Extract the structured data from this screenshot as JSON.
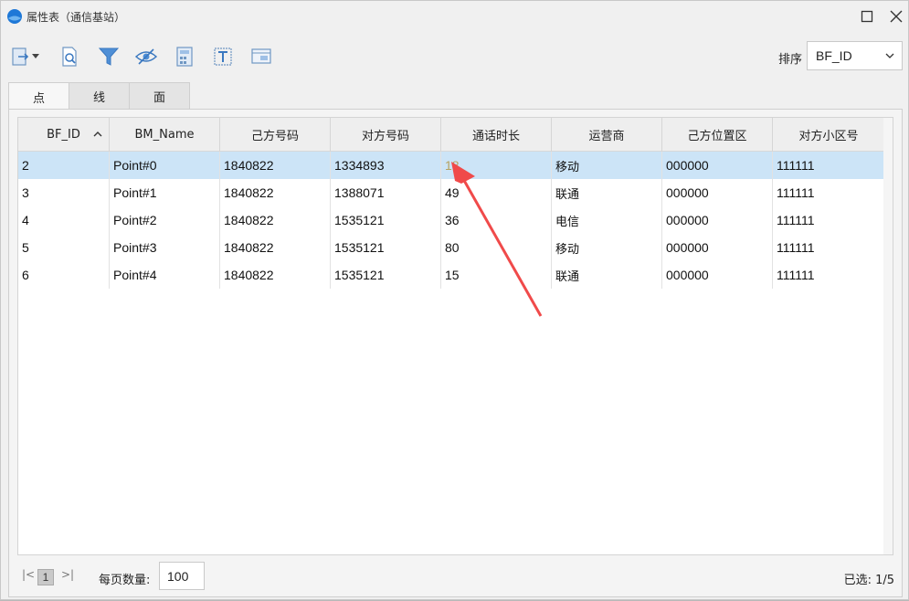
{
  "window": {
    "title": "属性表（通信基站）",
    "accent": "#1e78d7"
  },
  "toolbar": {
    "icons": [
      "export-icon",
      "dropdown-caret-icon",
      "zoom-to-icon",
      "filter-icon",
      "hide-icon",
      "calculator-icon",
      "field-text-icon",
      "field-manage-icon"
    ],
    "sort_label": "排序",
    "sort_value": "BF_ID"
  },
  "tabs": [
    {
      "label": "点",
      "active": true
    },
    {
      "label": "线",
      "active": false
    },
    {
      "label": "面",
      "active": false
    }
  ],
  "table": {
    "columns": [
      "BF_ID",
      "BM_Name",
      "己方号码",
      "对方号码",
      "通话时长",
      "运营商",
      "己方位置区",
      "对方小区号"
    ],
    "rows": [
      [
        "2",
        "Point#0",
        "1840822",
        "1334893",
        "18",
        "移动",
        "000000",
        "111111"
      ],
      [
        "3",
        "Point#1",
        "1840822",
        "1388071",
        "49",
        "联通",
        "000000",
        "111111"
      ],
      [
        "4",
        "Point#2",
        "1840822",
        "1535121",
        "36",
        "电信",
        "000000",
        "111111"
      ],
      [
        "5",
        "Point#3",
        "1840822",
        "1535121",
        "80",
        "移动",
        "000000",
        "111111"
      ],
      [
        "6",
        "Point#4",
        "1840822",
        "1535121",
        "15",
        "联通",
        "000000",
        "111111"
      ]
    ],
    "selected_row": 0,
    "selection_color": "#cce4f7"
  },
  "footer": {
    "current_page": "1",
    "per_page_label": "每页数量:",
    "per_page_value": "100",
    "selected_status": "已选: 1/5"
  },
  "annotation": {
    "arrow_color": "#f04a4a",
    "highlight_color": "#ffe828"
  }
}
